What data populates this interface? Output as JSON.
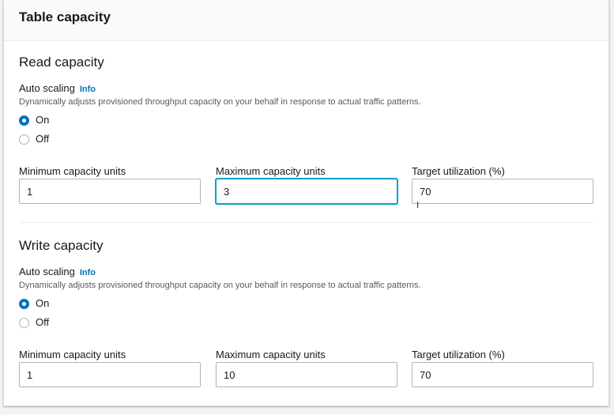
{
  "panel": {
    "title": "Table capacity"
  },
  "read": {
    "title": "Read capacity",
    "autoscaling_label": "Auto scaling",
    "info_label": "Info",
    "description": "Dynamically adjusts provisioned throughput capacity on your behalf in response to actual traffic patterns.",
    "on_label": "On",
    "off_label": "Off",
    "selected": "On",
    "min_label": "Minimum capacity units",
    "min_value": "1",
    "max_label": "Maximum capacity units",
    "max_value": "3",
    "target_label": "Target utilization (%)",
    "target_value": "70"
  },
  "write": {
    "title": "Write capacity",
    "autoscaling_label": "Auto scaling",
    "info_label": "Info",
    "description": "Dynamically adjusts provisioned throughput capacity on your behalf in response to actual traffic patterns.",
    "on_label": "On",
    "off_label": "Off",
    "selected": "On",
    "min_label": "Minimum capacity units",
    "min_value": "1",
    "max_label": "Maximum capacity units",
    "max_value": "10",
    "target_label": "Target utilization (%)",
    "target_value": "70"
  },
  "colors": {
    "accent": "#0073bb",
    "focus": "#00a1c9",
    "panel_bg": "#ffffff",
    "page_bg": "#f2f3f3"
  }
}
